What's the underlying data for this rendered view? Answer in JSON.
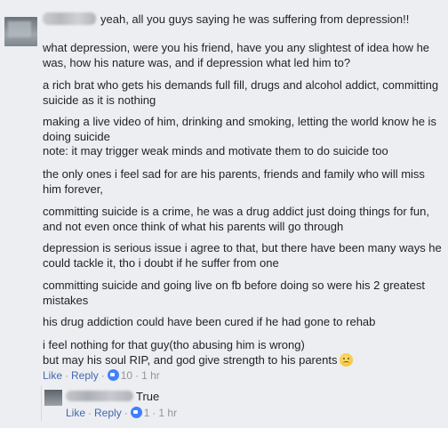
{
  "comment": {
    "first_line": "yeah, all you guys saying he was suffering from depression!!",
    "paragraphs": [
      "what depression, were you his friend, have you any slightest of idea how he was, how his nature was, and if depression what led him to?",
      "a rich brat who gets his demands full fill, drugs and alcohol addict, committing suicide as it is nothing",
      "making a live video of him, drinking and smoking, letting the world know he is doing suicide",
      "note: it may trigger weak minds and motivate them to do suicide too",
      "the only ones i feel sad for are his parents, friends and family who will miss him forever,",
      "committing suicide is a crime, he was a drug addict just doing things for fun, and not even once think of what his parents will go through",
      "depression is serious issue i agree to that, but there have been many ways he could tackle it, tho i doubt if he suffer from one",
      "committing suicide and going live on fb before doing so were his 2 greatest mistakes",
      "his drug addiction could have been cured if he had gone to rehab",
      "i feel nothing for that guy(tho abusing him is wrong)",
      "but may his soul RIP, and god give strength to his parents"
    ],
    "emoji_icon": "sad-face-emoji-icon",
    "actions": {
      "like": "Like",
      "reply": "Reply",
      "like_count": "10",
      "time": "1 hr"
    }
  },
  "reply": {
    "text": "True",
    "actions": {
      "like": "Like",
      "reply": "Reply",
      "like_count": "1",
      "time": "1 hr"
    }
  },
  "colors": {
    "background": "#edeef1",
    "link": "#4267b2",
    "meta": "#90949c",
    "like_badge": "#4080ff"
  }
}
